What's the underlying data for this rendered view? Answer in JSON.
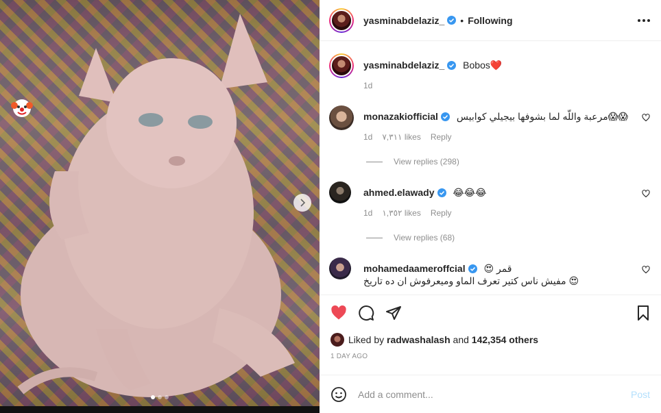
{
  "post": {
    "username": "yasminabdelaziz_",
    "separator": "•",
    "follow_status": "Following",
    "caption": "Bobos❤️",
    "caption_time": "1d"
  },
  "comments": [
    {
      "username": "monazakiofficial",
      "text": "😱😱مرعبة واللّه لما بشوفها بيجيلي كوابيس",
      "time": "1d",
      "likes": "٧,٣١١ likes",
      "reply_label": "Reply",
      "view_replies": "View replies (298)"
    },
    {
      "username": "ahmed.elawady",
      "text": "😂😂😂",
      "time": "1d",
      "likes": "١,٣٥٢ likes",
      "reply_label": "Reply",
      "view_replies": "View replies (68)"
    },
    {
      "username": "mohamedaameroffcial",
      "text": "قمر 😍",
      "text2": "😍 مفيش ناس كتير تعرف الماو وميعرفوش ان ده تاريخ"
    }
  ],
  "likes": {
    "prefix": "Liked by",
    "liker": "radwashalash",
    "middle": "and",
    "others": "142,354 others"
  },
  "time_ago": "1 DAY AGO",
  "add_comment": {
    "placeholder": "Add a comment...",
    "post_label": "Post"
  },
  "colors": {
    "heart": "#ed4956",
    "verified": "#3897f0",
    "post_disabled": "#b2dffc"
  },
  "carousel": {
    "index": 1,
    "count": 3
  }
}
